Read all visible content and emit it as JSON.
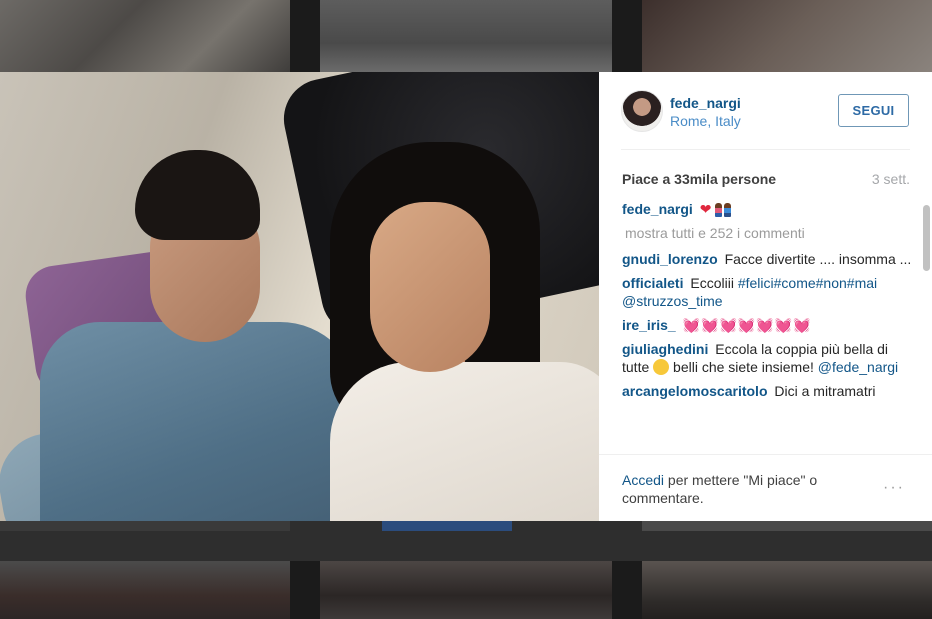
{
  "post": {
    "username": "fede_nargi",
    "location": "Rome, Italy",
    "follow_label": "SEGUI",
    "likes_text": "Piace a 33mila persone",
    "age": "3 sett.",
    "caption": {
      "user": "fede_nargi",
      "text": "❤"
    },
    "show_all_comments": "mostra tutti e 252 i commenti",
    "comments": [
      {
        "user": "gnudi_lorenzo",
        "text": "Facce divertite .... insomma ..."
      },
      {
        "user": "officialeti",
        "text": "Eccoliii",
        "tags": "#felici#come#non#mai",
        "mention": "@struzzos_time"
      },
      {
        "user": "ire_iris_",
        "text": "💓💓💓💓💓💓💓"
      },
      {
        "user": "giuliaghedini",
        "text": "Eccola la coppia più bella di tutte",
        "text2": "belli che siete insieme!",
        "mention": "@fede_nargi"
      },
      {
        "user": "arcangelomoscaritolo",
        "text": "Dici a mitramatri"
      }
    ],
    "login_link": "Accedi",
    "login_text": "per mettere \"Mi piace\" o commentare.",
    "more_icon": "···"
  },
  "colors": {
    "link": "#125688",
    "location": "#4a8cc7",
    "muted": "#a5a7aa"
  }
}
